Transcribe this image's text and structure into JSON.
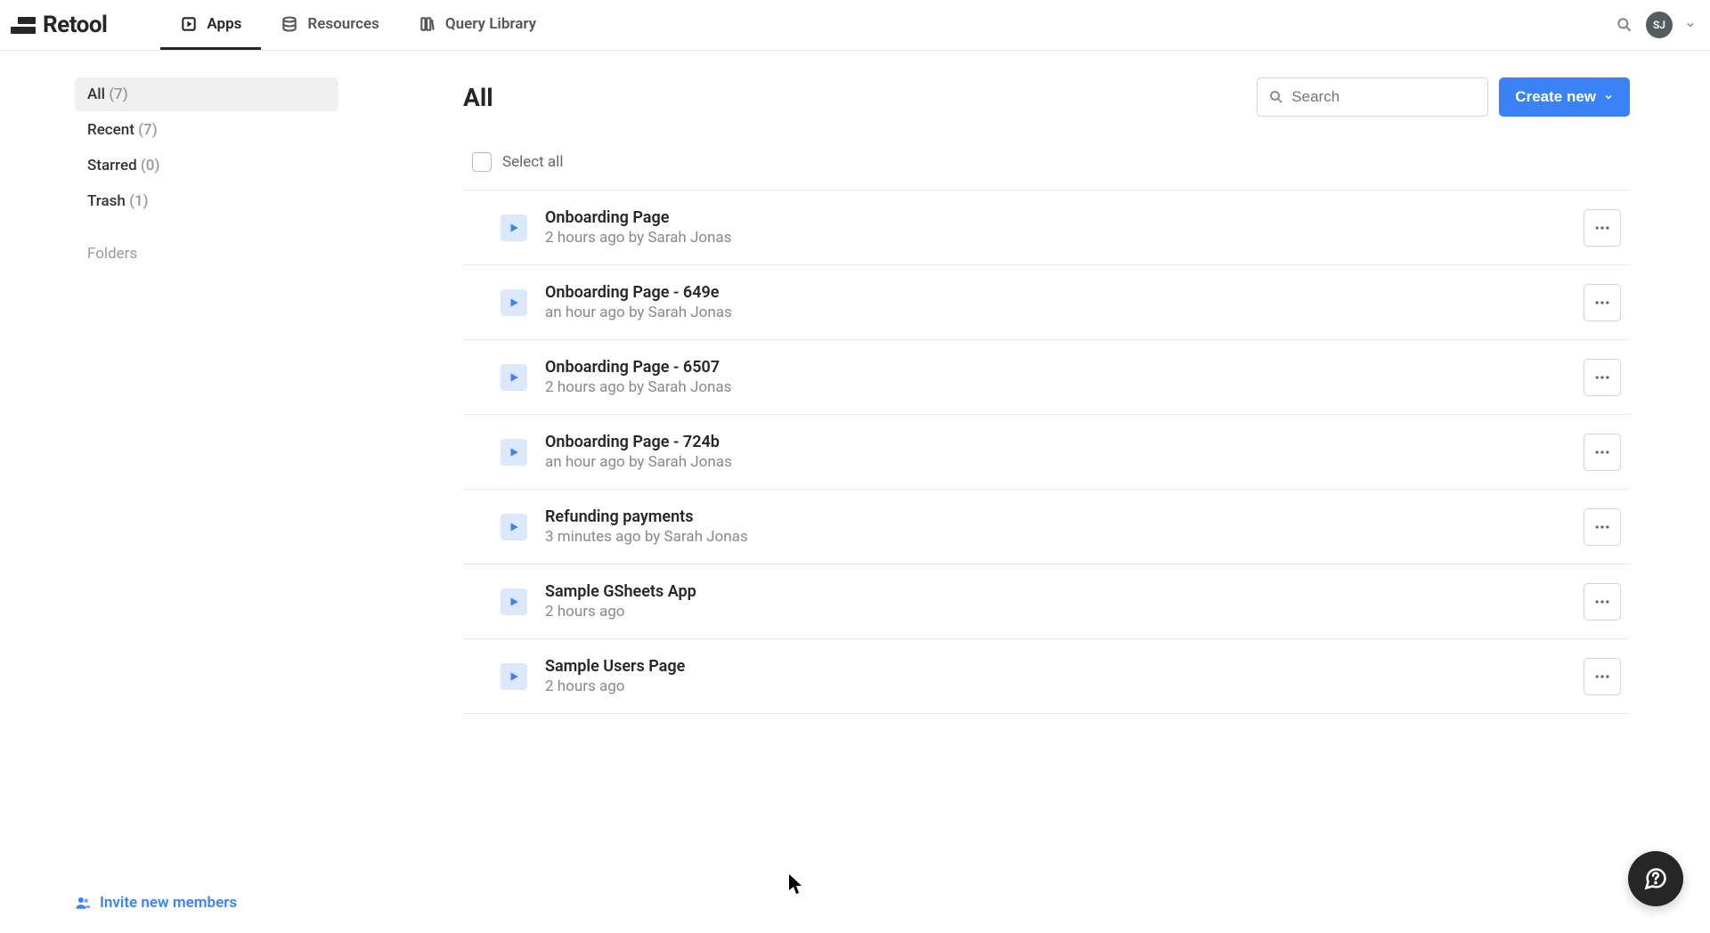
{
  "brand": "Retool",
  "nav": {
    "apps": "Apps",
    "resources": "Resources",
    "query_library": "Query Library"
  },
  "avatar_initials": "SJ",
  "sidebar": {
    "items": [
      {
        "label": "All",
        "count": "(7)",
        "active": true
      },
      {
        "label": "Recent",
        "count": "(7)",
        "active": false
      },
      {
        "label": "Starred",
        "count": "(0)",
        "active": false
      },
      {
        "label": "Trash",
        "count": "(1)",
        "active": false
      }
    ],
    "folders_label": "Folders",
    "invite_label": "Invite new members"
  },
  "page": {
    "title": "All",
    "search_placeholder": "Search",
    "create_label": "Create new",
    "select_all_label": "Select all"
  },
  "apps": [
    {
      "name": "Onboarding Page",
      "meta": "2 hours ago by Sarah Jonas"
    },
    {
      "name": "Onboarding Page - 649e",
      "meta": "an hour ago by Sarah Jonas"
    },
    {
      "name": "Onboarding Page - 6507",
      "meta": "2 hours ago by Sarah Jonas"
    },
    {
      "name": "Onboarding Page - 724b",
      "meta": "an hour ago by Sarah Jonas"
    },
    {
      "name": "Refunding payments",
      "meta": "3 minutes ago by Sarah Jonas"
    },
    {
      "name": "Sample GSheets App",
      "meta": "2 hours ago"
    },
    {
      "name": "Sample Users Page",
      "meta": "2 hours ago"
    }
  ]
}
